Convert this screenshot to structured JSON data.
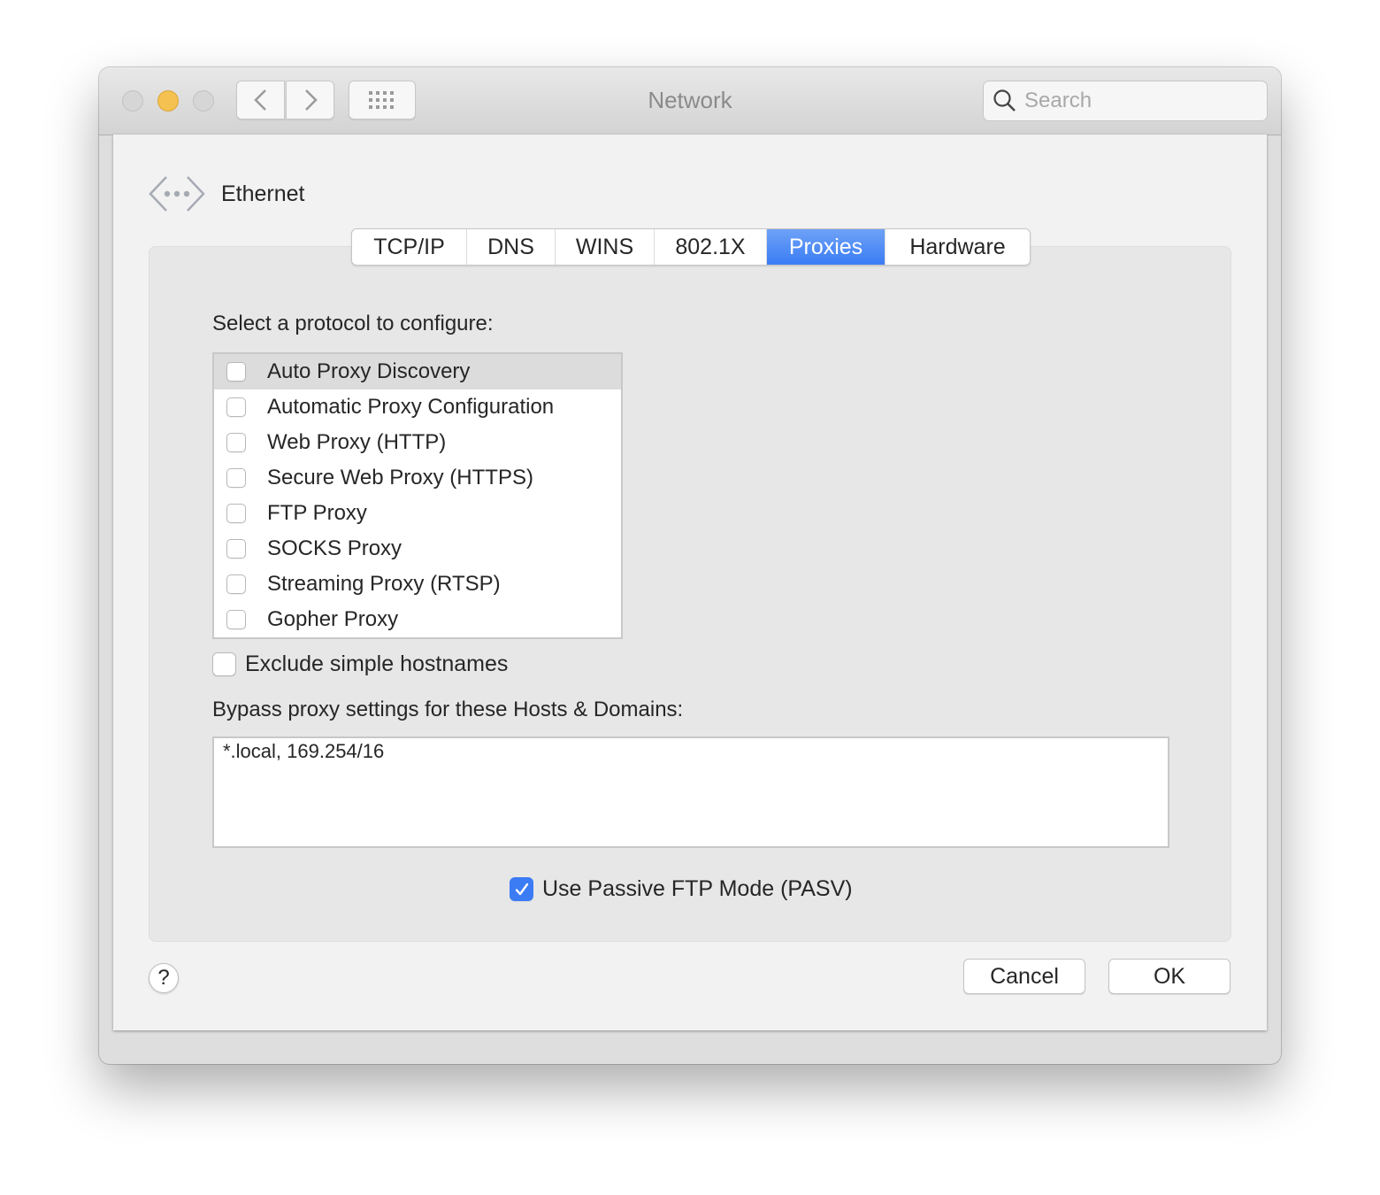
{
  "window": {
    "title": "Network",
    "traffic_lights": [
      "close",
      "minimize",
      "zoom"
    ],
    "nav": {
      "back_icon": "chevron-left-icon",
      "forward_icon": "chevron-right-icon",
      "grid_icon": "grid-icon"
    },
    "search": {
      "placeholder": "Search",
      "value": ""
    }
  },
  "sheet": {
    "interface": {
      "icon": "ethernet-icon",
      "name": "Ethernet"
    },
    "tabs": [
      {
        "label": "TCP/IP",
        "active": false
      },
      {
        "label": "DNS",
        "active": false
      },
      {
        "label": "WINS",
        "active": false
      },
      {
        "label": "802.1X",
        "active": false
      },
      {
        "label": "Proxies",
        "active": true
      },
      {
        "label": "Hardware",
        "active": false
      }
    ],
    "prompt": "Select a protocol to configure:",
    "protocols": [
      {
        "label": "Auto Proxy Discovery",
        "checked": false,
        "selected": true
      },
      {
        "label": "Automatic Proxy Configuration",
        "checked": false,
        "selected": false
      },
      {
        "label": "Web Proxy (HTTP)",
        "checked": false,
        "selected": false
      },
      {
        "label": "Secure Web Proxy (HTTPS)",
        "checked": false,
        "selected": false
      },
      {
        "label": "FTP Proxy",
        "checked": false,
        "selected": false
      },
      {
        "label": "SOCKS Proxy",
        "checked": false,
        "selected": false
      },
      {
        "label": "Streaming Proxy (RTSP)",
        "checked": false,
        "selected": false
      },
      {
        "label": "Gopher Proxy",
        "checked": false,
        "selected": false
      }
    ],
    "exclude_simple": {
      "label": "Exclude simple hostnames",
      "checked": false
    },
    "bypass": {
      "label": "Bypass proxy settings for these Hosts & Domains:",
      "value": "*.local, 169.254/16"
    },
    "passive_ftp": {
      "label": "Use Passive FTP Mode (PASV)",
      "checked": true
    },
    "help_label": "?",
    "cancel_label": "Cancel",
    "ok_label": "OK"
  },
  "colors": {
    "accent": "#3b7cf4",
    "minimize": "#f5c150"
  }
}
